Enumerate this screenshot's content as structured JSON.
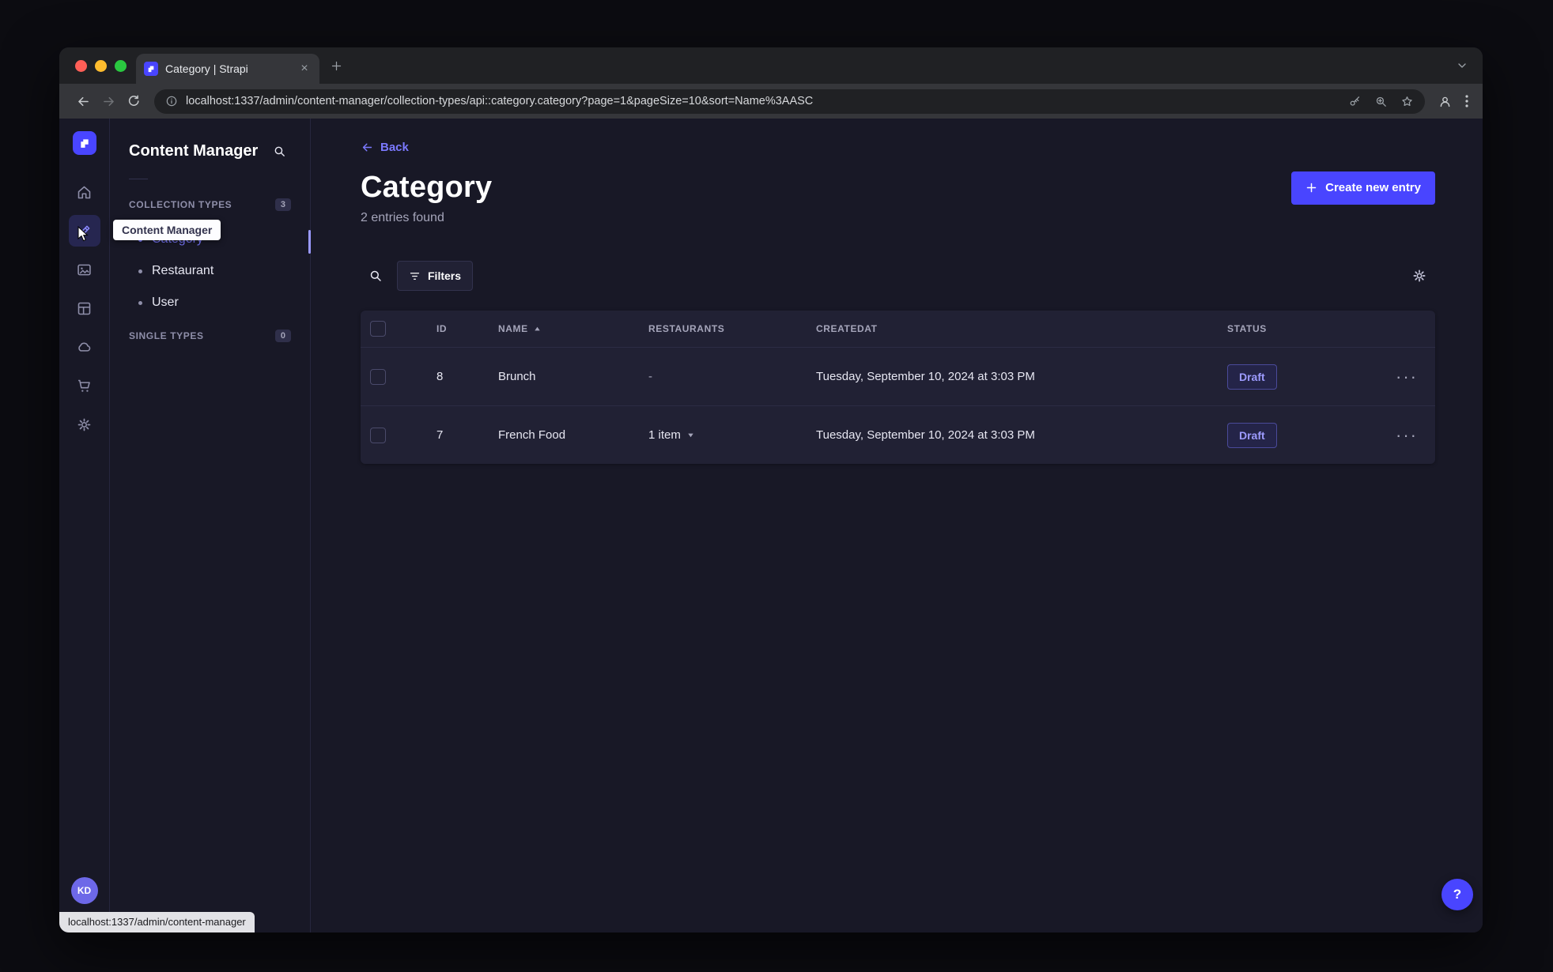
{
  "browser": {
    "tab_title": "Category | Strapi",
    "url": "localhost:1337/admin/content-manager/collection-types/api::category.category?page=1&pageSize=10&sort=Name%3AASC",
    "status_bubble": "localhost:1337/admin/content-manager"
  },
  "rail": {
    "avatar_initials": "KD"
  },
  "tooltip": {
    "text": "Content Manager"
  },
  "sidebar": {
    "title": "Content Manager",
    "collection_types_label": "COLLECTION TYPES",
    "collection_types_count": "3",
    "single_types_label": "SINGLE TYPES",
    "single_types_count": "0",
    "items": [
      {
        "label": "Category"
      },
      {
        "label": "Restaurant"
      },
      {
        "label": "User"
      }
    ]
  },
  "main": {
    "back_label": "Back",
    "title": "Category",
    "subtitle": "2 entries found",
    "create_button_label": "Create new entry",
    "filters_button_label": "Filters",
    "help_label": "?",
    "table": {
      "headers": {
        "id": "ID",
        "name": "NAME",
        "restaurants": "RESTAURANTS",
        "createdat": "CREATEDAT",
        "status": "STATUS"
      },
      "rows": [
        {
          "id": "8",
          "name": "Brunch",
          "restaurants": "-",
          "created_at": "Tuesday, September 10, 2024 at 3:03 PM",
          "status": "Draft"
        },
        {
          "id": "7",
          "name": "French Food",
          "restaurants": "1 item",
          "created_at": "Tuesday, September 10, 2024 at 3:03 PM",
          "status": "Draft"
        }
      ]
    }
  },
  "colors": {
    "primary": "#4945ff",
    "primary_light": "#7b79ff",
    "surface": "#212134",
    "background": "#181826"
  }
}
